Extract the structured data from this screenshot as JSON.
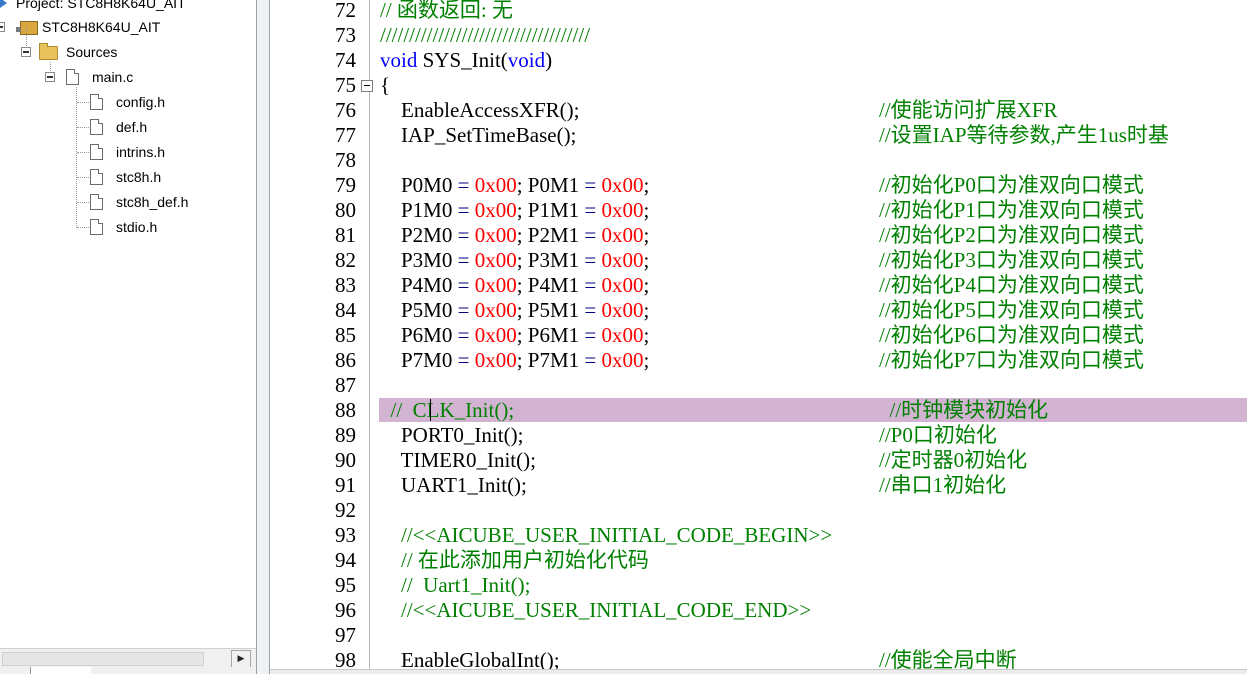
{
  "project_tree": {
    "project_label": "Project: STC8H8K64U_AIT",
    "target_label": "STC8H8K64U_AIT",
    "group_label": "Sources",
    "main_file": "main.c",
    "includes": [
      "config.h",
      "def.h",
      "intrins.h",
      "stc8h.h",
      "stc8h_def.h",
      "stdio.h"
    ]
  },
  "editor": {
    "lines": [
      {
        "num": "72",
        "parts": [
          {
            "t": "// 函数返回: 无",
            "c": "green"
          }
        ],
        "comment": ""
      },
      {
        "num": "73",
        "parts": [
          {
            "t": "////////////////////////////////////",
            "c": "green"
          }
        ],
        "comment": ""
      },
      {
        "num": "74",
        "parts": [
          {
            "t": "void",
            "c": "kw"
          },
          {
            "t": " SYS_Init(",
            "c": ""
          },
          {
            "t": "void",
            "c": "kw"
          },
          {
            "t": ")",
            "c": ""
          }
        ],
        "comment": ""
      },
      {
        "num": "75",
        "parts": [
          {
            "t": "{",
            "c": ""
          }
        ],
        "comment": "",
        "fold": true
      },
      {
        "num": "76",
        "parts": [
          {
            "t": "    EnableAccessXFR();",
            "c": ""
          }
        ],
        "comment": "//使能访问扩展XFR"
      },
      {
        "num": "77",
        "parts": [
          {
            "t": "    IAP_SetTimeBase();",
            "c": ""
          }
        ],
        "comment": "//设置IAP等待参数,产生1us时基"
      },
      {
        "num": "78",
        "parts": [],
        "comment": ""
      },
      {
        "num": "79",
        "parts": [
          {
            "t": "    P0M0 ",
            "c": ""
          },
          {
            "t": "=",
            "c": "op"
          },
          {
            "t": " ",
            "c": ""
          },
          {
            "t": "0x00",
            "c": "num"
          },
          {
            "t": "; P0M1 ",
            "c": ""
          },
          {
            "t": "=",
            "c": "op"
          },
          {
            "t": " ",
            "c": ""
          },
          {
            "t": "0x00",
            "c": "num"
          },
          {
            "t": ";",
            "c": ""
          }
        ],
        "comment": "//初始化P0口为准双向口模式"
      },
      {
        "num": "80",
        "parts": [
          {
            "t": "    P1M0 ",
            "c": ""
          },
          {
            "t": "=",
            "c": "op"
          },
          {
            "t": " ",
            "c": ""
          },
          {
            "t": "0x00",
            "c": "num"
          },
          {
            "t": "; P1M1 ",
            "c": ""
          },
          {
            "t": "=",
            "c": "op"
          },
          {
            "t": " ",
            "c": ""
          },
          {
            "t": "0x00",
            "c": "num"
          },
          {
            "t": ";",
            "c": ""
          }
        ],
        "comment": "//初始化P1口为准双向口模式"
      },
      {
        "num": "81",
        "parts": [
          {
            "t": "    P2M0 ",
            "c": ""
          },
          {
            "t": "=",
            "c": "op"
          },
          {
            "t": " ",
            "c": ""
          },
          {
            "t": "0x00",
            "c": "num"
          },
          {
            "t": "; P2M1 ",
            "c": ""
          },
          {
            "t": "=",
            "c": "op"
          },
          {
            "t": " ",
            "c": ""
          },
          {
            "t": "0x00",
            "c": "num"
          },
          {
            "t": ";",
            "c": ""
          }
        ],
        "comment": "//初始化P2口为准双向口模式"
      },
      {
        "num": "82",
        "parts": [
          {
            "t": "    P3M0 ",
            "c": ""
          },
          {
            "t": "=",
            "c": "op"
          },
          {
            "t": " ",
            "c": ""
          },
          {
            "t": "0x00",
            "c": "num"
          },
          {
            "t": "; P3M1 ",
            "c": ""
          },
          {
            "t": "=",
            "c": "op"
          },
          {
            "t": " ",
            "c": ""
          },
          {
            "t": "0x00",
            "c": "num"
          },
          {
            "t": ";",
            "c": ""
          }
        ],
        "comment": "//初始化P3口为准双向口模式"
      },
      {
        "num": "83",
        "parts": [
          {
            "t": "    P4M0 ",
            "c": ""
          },
          {
            "t": "=",
            "c": "op"
          },
          {
            "t": " ",
            "c": ""
          },
          {
            "t": "0x00",
            "c": "num"
          },
          {
            "t": "; P4M1 ",
            "c": ""
          },
          {
            "t": "=",
            "c": "op"
          },
          {
            "t": " ",
            "c": ""
          },
          {
            "t": "0x00",
            "c": "num"
          },
          {
            "t": ";",
            "c": ""
          }
        ],
        "comment": "//初始化P4口为准双向口模式"
      },
      {
        "num": "84",
        "parts": [
          {
            "t": "    P5M0 ",
            "c": ""
          },
          {
            "t": "=",
            "c": "op"
          },
          {
            "t": " ",
            "c": ""
          },
          {
            "t": "0x00",
            "c": "num"
          },
          {
            "t": "; P5M1 ",
            "c": ""
          },
          {
            "t": "=",
            "c": "op"
          },
          {
            "t": " ",
            "c": ""
          },
          {
            "t": "0x00",
            "c": "num"
          },
          {
            "t": ";",
            "c": ""
          }
        ],
        "comment": "//初始化P5口为准双向口模式"
      },
      {
        "num": "85",
        "parts": [
          {
            "t": "    P6M0 ",
            "c": ""
          },
          {
            "t": "=",
            "c": "op"
          },
          {
            "t": " ",
            "c": ""
          },
          {
            "t": "0x00",
            "c": "num"
          },
          {
            "t": "; P6M1 ",
            "c": ""
          },
          {
            "t": "=",
            "c": "op"
          },
          {
            "t": " ",
            "c": ""
          },
          {
            "t": "0x00",
            "c": "num"
          },
          {
            "t": ";",
            "c": ""
          }
        ],
        "comment": "//初始化P6口为准双向口模式"
      },
      {
        "num": "86",
        "parts": [
          {
            "t": "    P7M0 ",
            "c": ""
          },
          {
            "t": "=",
            "c": "op"
          },
          {
            "t": " ",
            "c": ""
          },
          {
            "t": "0x00",
            "c": "num"
          },
          {
            "t": "; P7M1 ",
            "c": ""
          },
          {
            "t": "=",
            "c": "op"
          },
          {
            "t": " ",
            "c": ""
          },
          {
            "t": "0x00",
            "c": "num"
          },
          {
            "t": ";",
            "c": ""
          }
        ],
        "comment": "//初始化P7口为准双向口模式"
      },
      {
        "num": "87",
        "parts": [],
        "comment": ""
      },
      {
        "num": "88",
        "parts": [
          {
            "t": "  //  CLK_Init();",
            "c": "green"
          }
        ],
        "comment": "  //时钟模块初始化",
        "highlight": true
      },
      {
        "num": "89",
        "parts": [
          {
            "t": "    PORT0_Init();",
            "c": ""
          }
        ],
        "comment": "//P0口初始化"
      },
      {
        "num": "90",
        "parts": [
          {
            "t": "    TIMER0_Init();",
            "c": ""
          }
        ],
        "comment": "//定时器0初始化"
      },
      {
        "num": "91",
        "parts": [
          {
            "t": "    UART1_Init();",
            "c": ""
          }
        ],
        "comment": "//串口1初始化"
      },
      {
        "num": "92",
        "parts": [],
        "comment": ""
      },
      {
        "num": "93",
        "parts": [
          {
            "t": "    //<<AICUBE_USER_INITIAL_CODE_BEGIN>>",
            "c": "green"
          }
        ],
        "comment": ""
      },
      {
        "num": "94",
        "parts": [
          {
            "t": "    // 在此添加用户初始化代码",
            "c": "green"
          }
        ],
        "comment": ""
      },
      {
        "num": "95",
        "parts": [
          {
            "t": "    //  Uart1_Init();",
            "c": "green"
          }
        ],
        "comment": ""
      },
      {
        "num": "96",
        "parts": [
          {
            "t": "    //<<AICUBE_USER_INITIAL_CODE_END>>",
            "c": "green"
          }
        ],
        "comment": ""
      },
      {
        "num": "97",
        "parts": [],
        "comment": ""
      },
      {
        "num": "98",
        "parts": [
          {
            "t": "    EnableGlobalInt();",
            "c": ""
          }
        ],
        "comment": "//使能全局中断"
      }
    ]
  },
  "colors": {
    "keyword": "#0000ff",
    "number": "#ff0000",
    "comment": "#008000",
    "highlight_line": "#d2b4d2"
  }
}
